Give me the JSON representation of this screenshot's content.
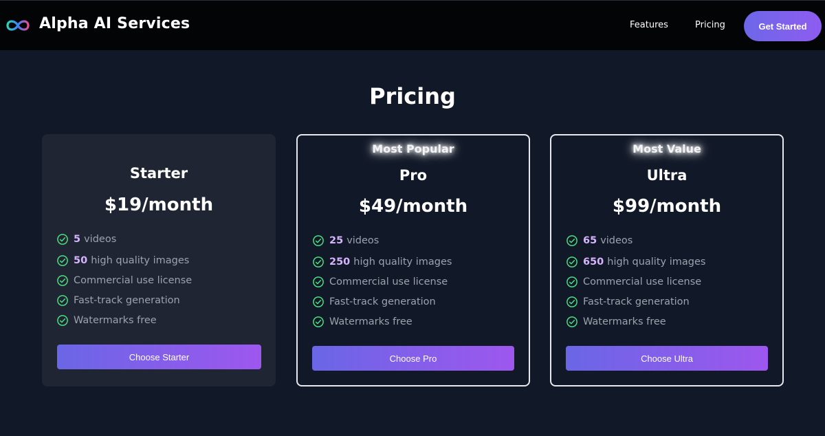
{
  "header": {
    "brand": "Alpha AI Services",
    "nav": {
      "features": "Features",
      "pricing": "Pricing"
    },
    "cta": "Get Started"
  },
  "page_title": "Pricing",
  "plans": [
    {
      "badge": "",
      "name": "Starter",
      "price": "$19/month",
      "features": [
        {
          "value": "5",
          "text": "videos"
        },
        {
          "value": "50",
          "text": "high quality images"
        },
        {
          "value": "",
          "text": "Commercial use license"
        },
        {
          "value": "",
          "text": "Fast-track generation"
        },
        {
          "value": "",
          "text": "Watermarks free"
        }
      ],
      "button": "Choose Starter"
    },
    {
      "badge": "Most Popular",
      "name": "Pro",
      "price": "$49/month",
      "features": [
        {
          "value": "25",
          "text": "videos"
        },
        {
          "value": "250",
          "text": "high quality images"
        },
        {
          "value": "",
          "text": "Commercial use license"
        },
        {
          "value": "",
          "text": "Fast-track generation"
        },
        {
          "value": "",
          "text": "Watermarks free"
        }
      ],
      "button": "Choose Pro"
    },
    {
      "badge": "Most Value",
      "name": "Ultra",
      "price": "$99/month",
      "features": [
        {
          "value": "65",
          "text": "videos"
        },
        {
          "value": "650",
          "text": "high quality images"
        },
        {
          "value": "",
          "text": "Commercial use license"
        },
        {
          "value": "",
          "text": "Fast-track generation"
        },
        {
          "value": "",
          "text": "Watermarks free"
        }
      ],
      "button": "Choose Ultra"
    }
  ],
  "icons": {
    "logo": "infinity-logo-icon",
    "feature": "check-circle-icon"
  },
  "colors": {
    "background": "#111827",
    "header": "#030406",
    "card": "#1f2532",
    "accent_start": "#6a66e6",
    "accent_end": "#9e57ee",
    "highlight": "#d6b4fe",
    "check": "#4ade80"
  }
}
